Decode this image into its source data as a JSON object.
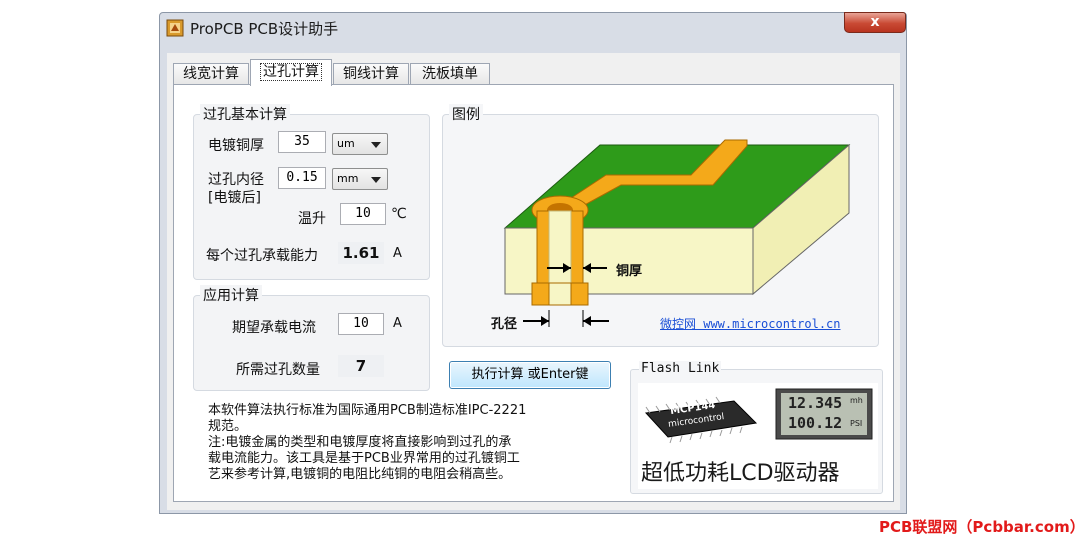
{
  "window": {
    "title": "ProPCB PCB设计助手",
    "close_label": "x"
  },
  "tabs": [
    {
      "label": "线宽计算",
      "active": false
    },
    {
      "label": "过孔计算",
      "active": true
    },
    {
      "label": "铜线计算",
      "active": false
    },
    {
      "label": "洗板填单",
      "active": false
    }
  ],
  "basic": {
    "group_label": "过孔基本计算",
    "plating_label": "电镀铜厚",
    "plating_value": "35",
    "plating_unit": "um",
    "diameter_label": "过孔内径",
    "diameter_sub": "[电镀后]",
    "diameter_value": "0.15",
    "diameter_unit": "mm",
    "temp_label": "温升",
    "temp_value": "10",
    "temp_unit": "℃",
    "capacity_label": "每个过孔承载能力",
    "capacity_value": "1.61",
    "capacity_unit": "A"
  },
  "app": {
    "group_label": "应用计算",
    "current_label": "期望承载电流",
    "current_value": "10",
    "current_unit": "A",
    "count_label": "所需过孔数量",
    "count_value": "7"
  },
  "notes": {
    "line1": "本软件算法执行标准为国际通用PCB制造标准IPC-2221",
    "line2": "规范。",
    "line3": "注:电镀金属的类型和电镀厚度将直接影响到过孔的承",
    "line4": "载电流能力。该工具是基于PCB业界常用的过孔镀铜工",
    "line5": "艺来参考计算,电镀铜的电阻比纯铜的电阻会稍高些。"
  },
  "figure": {
    "group_label": "图例",
    "thickness_label": "铜厚",
    "diameter_label": "孔径",
    "link_text": "微控网 www.microcontrol.cn"
  },
  "calc_button": "执行计算 或Enter键",
  "flash": {
    "label": "Flash Link",
    "chip_text": "MCP144",
    "chip_sub": "microcontrol",
    "lcd_top": "12.345",
    "lcd_bottom": "100.12",
    "lcd_unit_top": "mh",
    "lcd_unit_bottom": "PSI",
    "slogan": "超低功耗LCD驱动器"
  },
  "watermark": "PCB联盟网（Pcbbar.com）",
  "colors": {
    "board_green": "#2e9b1a",
    "board_body": "#f7f6c6",
    "copper": "#f4a91a",
    "link_blue": "#1a4fd6",
    "watermark_red": "#e21a1a"
  }
}
